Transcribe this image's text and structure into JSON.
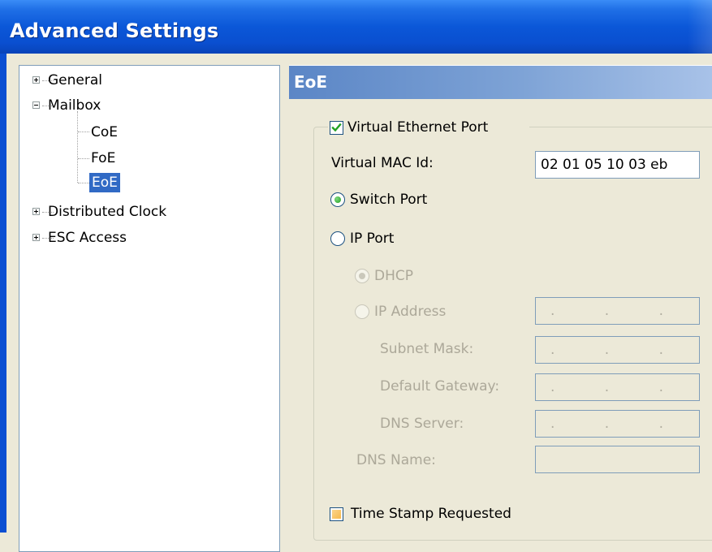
{
  "window": {
    "title": "Advanced Settings"
  },
  "tree": {
    "items": [
      {
        "label": "General",
        "expander": "plus"
      },
      {
        "label": "Mailbox",
        "expander": "minus"
      },
      {
        "label": "CoE"
      },
      {
        "label": "FoE"
      },
      {
        "label": "EoE",
        "selected": true
      },
      {
        "label": "Distributed Clock",
        "expander": "plus"
      },
      {
        "label": "ESC Access",
        "expander": "plus"
      }
    ]
  },
  "panel": {
    "title": "EoE",
    "virtual_ethernet_port": {
      "label": "Virtual Ethernet Port",
      "checked": true
    },
    "virtual_mac": {
      "label": "Virtual MAC Id:",
      "value": "02 01 05 10 03 eb"
    },
    "switch_port": {
      "label": "Switch Port",
      "selected": true
    },
    "ip_port": {
      "label": "IP Port",
      "selected": false
    },
    "dhcp": {
      "label": "DHCP",
      "selected": true,
      "disabled": true
    },
    "ip_address": {
      "label": "IP Address",
      "disabled": true,
      "value": ". . ."
    },
    "subnet_mask": {
      "label": "Subnet Mask:",
      "value": ". . ."
    },
    "default_gateway": {
      "label": "Default Gateway:",
      "value": ". . ."
    },
    "dns_server": {
      "label": "DNS Server:",
      "value": ". . ."
    },
    "dns_name": {
      "label": "DNS Name:",
      "value": ""
    },
    "time_stamp": {
      "label": "Time Stamp Requested",
      "checked": false
    }
  },
  "colors": {
    "title_bar": "#0b57d8",
    "selection": "#316ac5",
    "panel_header": "#7ea3d6",
    "radio_on": "#21a121"
  }
}
